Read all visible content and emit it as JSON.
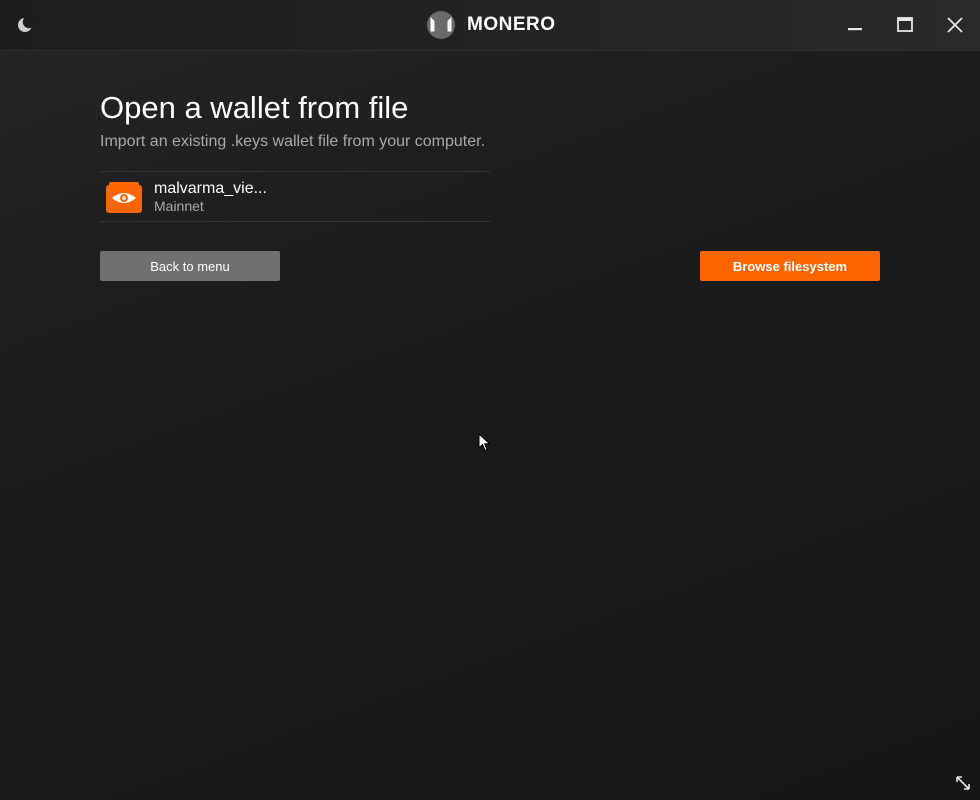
{
  "window": {
    "brand_name": "MONERO",
    "controls": {
      "theme_icon": "moon-icon",
      "minimize_icon": "minimize-icon",
      "maximize_icon": "maximize-icon",
      "close_icon": "close-icon"
    }
  },
  "page": {
    "title": "Open a wallet from file",
    "subtitle": "Import an existing .keys wallet file from your computer."
  },
  "wallets": [
    {
      "name": "malvarma_vie...",
      "network": "Mainnet",
      "icon": "view-only-wallet-icon"
    }
  ],
  "buttons": {
    "back_label": "Back to menu",
    "browse_label": "Browse filesystem"
  },
  "colors": {
    "accent": "#ff6600",
    "secondary_button": "#707070",
    "background": "#171717",
    "muted_text": "#a9a9a9"
  }
}
